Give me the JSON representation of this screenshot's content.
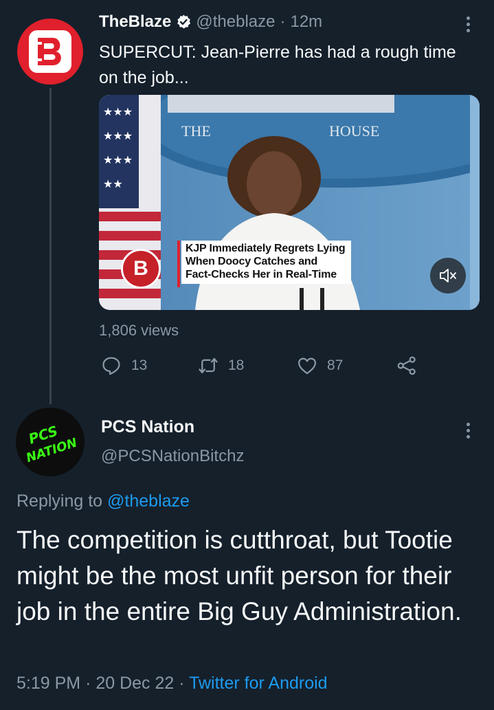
{
  "tweet": {
    "author_name": "TheBlaze",
    "handle": "@theblaze",
    "separator": "·",
    "time": "12m",
    "text": "SUPERCUT: Jean-Pierre has had a rough time on the job...",
    "media": {
      "sign_text_left": "THE",
      "sign_text_right": "HOUSE",
      "caption_line1": "KJP Immediately Regrets Lying",
      "caption_line2": "When Doocy Catches and",
      "caption_line3": "Fact-Checks Her in Real-Time",
      "logo_letter": "B"
    },
    "views": "1,806 views",
    "replies": "13",
    "retweets": "18",
    "likes": "87"
  },
  "reply": {
    "author_name": "PCS Nation",
    "handle": "@PCSNationBitchz",
    "avatar_text_line1": "PCS",
    "avatar_text_line2": "NATION",
    "replying_prefix": "Replying to",
    "replying_handle": "@theblaze",
    "text": "The competition is cutthroat, but Tootie might be the most unfit person for their job in the entire Big Guy Administration.",
    "time": "5:19 PM",
    "separator1": "·",
    "date": "20 Dec 22",
    "separator2": "·",
    "source": "Twitter for Android"
  },
  "colors": {
    "background": "#15202b",
    "text": "#f7f9f9",
    "muted": "#8b98a5",
    "link": "#1d9bf0",
    "blaze_red": "#e0202c",
    "pcs_green": "#39ff14"
  },
  "icons": [
    "verified-badge-icon",
    "more-options-icon",
    "reply-icon",
    "retweet-icon",
    "like-icon",
    "share-icon",
    "mute-icon"
  ]
}
